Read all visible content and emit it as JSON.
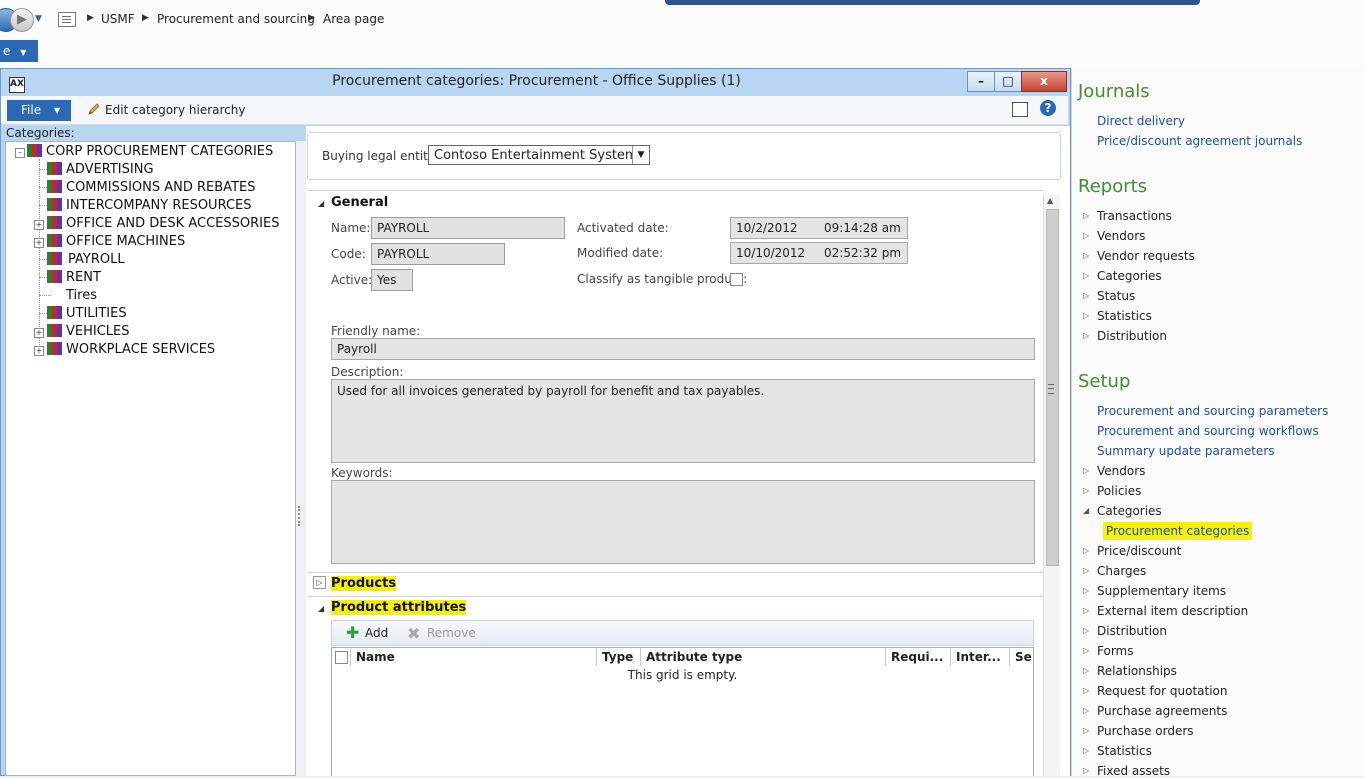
{
  "breadcrumb": [
    "USMF",
    "Procurement and sourcing",
    "Area page"
  ],
  "window": {
    "title": "Procurement categories: Procurement - Office Supplies (1)",
    "app_icon": "AX",
    "btn_minimize": "–",
    "btn_maximize": "□",
    "btn_close": "x"
  },
  "toolbar": {
    "file_label": "File",
    "edit_hierarchy_label": "Edit category hierarchy",
    "help_glyph": "?"
  },
  "left_strip_label": "e",
  "categories_label": "Categories:",
  "tree": {
    "root": "CORP PROCUREMENT CATEGORIES",
    "items": [
      {
        "label": "ADVERTISING",
        "expandable": false
      },
      {
        "label": "COMMISSIONS AND REBATES",
        "expandable": false
      },
      {
        "label": "INTERCOMPANY RESOURCES",
        "expandable": false
      },
      {
        "label": "OFFICE AND DESK ACCESSORIES",
        "expandable": true
      },
      {
        "label": "OFFICE MACHINES",
        "expandable": true
      },
      {
        "label": "PAYROLL",
        "expandable": false,
        "selected": true
      },
      {
        "label": "RENT",
        "expandable": false
      },
      {
        "label": "Tires",
        "expandable": false
      },
      {
        "label": "UTILITIES",
        "expandable": false
      },
      {
        "label": "VEHICLES",
        "expandable": true
      },
      {
        "label": "WORKPLACE SERVICES",
        "expandable": true
      }
    ]
  },
  "buying": {
    "label": "Buying legal entity:",
    "value": "Contoso Entertainment System"
  },
  "general": {
    "header": "General",
    "name_label": "Name:",
    "name_value": "PAYROLL",
    "code_label": "Code:",
    "code_value": "PAYROLL",
    "active_label": "Active:",
    "active_value": "Yes",
    "activated_label": "Activated date:",
    "activated_date": "10/2/2012",
    "activated_time": "09:14:28 am",
    "modified_label": "Modified date:",
    "modified_date": "10/10/2012",
    "modified_time": "02:52:32 pm",
    "tangible_label": "Classify as tangible product:",
    "friendly_label": "Friendly name:",
    "friendly_value": "Payroll",
    "description_label": "Description:",
    "description_value": "Used for all invoices generated by payroll for benefit and tax payables.",
    "keywords_label": "Keywords:",
    "keywords_value": ""
  },
  "products_header": "Products",
  "attributes": {
    "header": "Product attributes",
    "add_label": "Add",
    "remove_label": "Remove",
    "columns": [
      "Name",
      "Type",
      "Attribute type",
      "Requi...",
      "Inter...",
      "Se"
    ],
    "empty_text": "This grid is empty."
  },
  "area": {
    "journals": {
      "title": "Journals",
      "links": [
        "Direct delivery",
        "Price/discount agreement journals"
      ]
    },
    "reports": {
      "title": "Reports",
      "items": [
        "Transactions",
        "Vendors",
        "Vendor requests",
        "Categories",
        "Status",
        "Statistics",
        "Distribution"
      ]
    },
    "setup": {
      "title": "Setup",
      "links": [
        "Procurement and sourcing parameters",
        "Procurement and sourcing workflows",
        "Summary update parameters"
      ],
      "items_before": [
        "Vendors",
        "Policies"
      ],
      "expanded_item": "Categories",
      "sub_link": "Procurement categories",
      "items_after": [
        "Price/discount",
        "Charges",
        "Supplementary items",
        "External item description",
        "Distribution",
        "Forms",
        "Relationships",
        "Request for quotation",
        "Purchase agreements",
        "Purchase orders",
        "Statistics",
        "Fixed assets"
      ]
    }
  },
  "colors": {
    "accent_blue": "#2b68b5",
    "highlight": "#f5f10a",
    "heading_green": "#3f8f2e",
    "link_blue": "#1f4fa3"
  }
}
